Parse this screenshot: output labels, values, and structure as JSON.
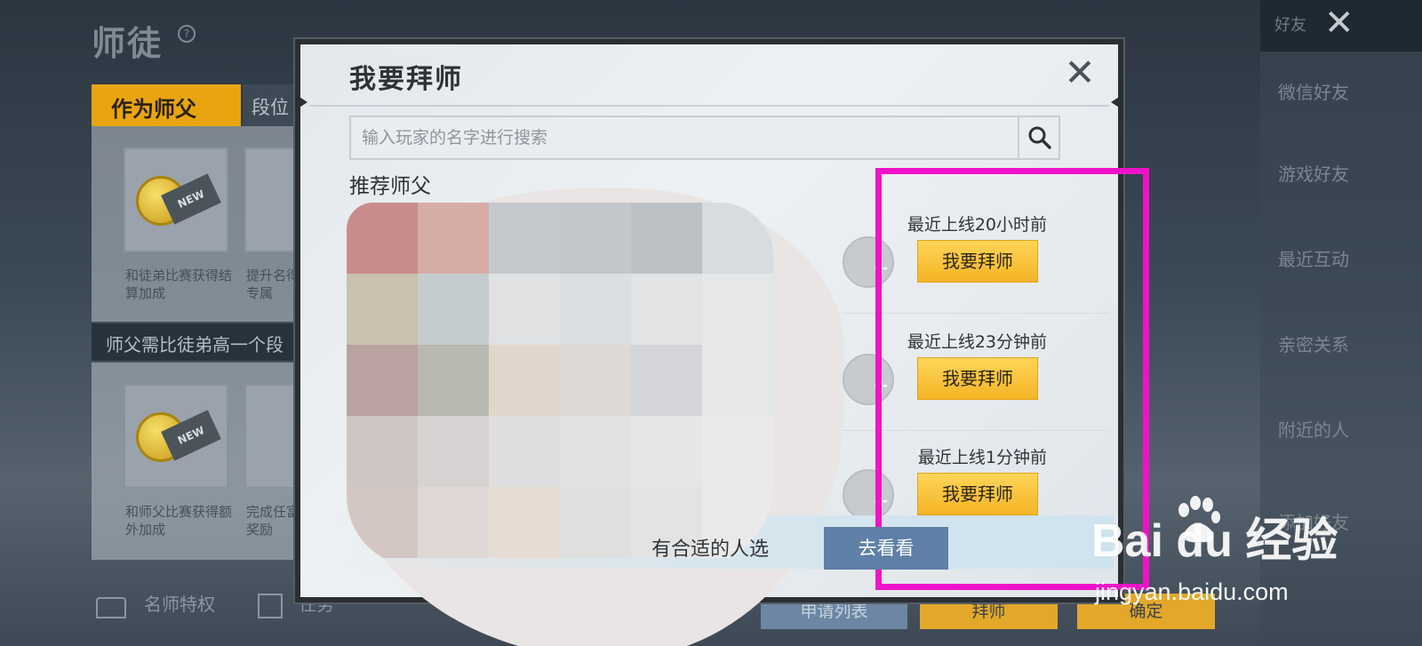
{
  "background": {
    "title": "师徒",
    "help_icon": "question-icon",
    "tabs": [
      {
        "label": "作为师父",
        "active": true
      },
      {
        "label": "段位",
        "active": false
      }
    ],
    "cards_row1": [
      {
        "text": "和徒弟比赛获得结算加成"
      },
      {
        "text": "提升名得专属"
      }
    ],
    "requirement_strip": "师父需比徒弟高一个段",
    "cards_row2": [
      {
        "text": "和师父比赛获得额外加成"
      },
      {
        "text": "完成任富奖励"
      }
    ],
    "badge_text": "NEW",
    "bottom_bar": {
      "privilege_label": "名师特权",
      "task_label": "任务",
      "apply_list_label": "申请列表",
      "apprentice_label": "拜师",
      "confirm_label": "确定"
    },
    "friends_panel": {
      "tab_label": "好友",
      "items": [
        "微信好友",
        "游戏好友",
        "最近互动",
        "亲密关系",
        "附近的人",
        "添加好友"
      ]
    }
  },
  "dialog": {
    "title": "我要拜师",
    "search": {
      "placeholder": "输入玩家的名字进行搜索"
    },
    "section_title": "推荐师父",
    "candidates": [
      {
        "status": "最近上线20小时前",
        "button_label": "我要拜师"
      },
      {
        "status": "最近上线23分钟前",
        "button_label": "我要拜师"
      },
      {
        "status": "最近上线1分钟前",
        "button_label": "我要拜师"
      }
    ],
    "footer": {
      "hint_text": "有合适的人选",
      "button_label": "去看看"
    }
  },
  "mosaic_colors": [
    [
      "#c98c8c",
      "#d6ada6",
      "#c4c8cc",
      "#c3c7cc",
      "#bcc1c6",
      "#d8dce0"
    ],
    [
      "#c9c0ad",
      "#c5ccce",
      "#dfe1e3",
      "#dcdfe2",
      "#e1e3e5",
      "#e5e7e8"
    ],
    [
      "#b9a29f",
      "#b8b9b0",
      "#e2d6cc",
      "#dfd9d6",
      "#d3d5d8",
      "#e6e7e8"
    ],
    [
      "#cfc5c2",
      "#d8d3d3",
      "#dedede",
      "#e3e2e2",
      "#e7e6e6",
      "#eaeaea"
    ],
    [
      "#d4c7c3",
      "#e0d8d5",
      "#e7dcd4",
      "#dfdfdf",
      "#e3e3e3",
      "#eaeaea"
    ]
  ],
  "annotation": {
    "color": "#f012c8"
  },
  "watermark": {
    "logo_text": "Bai du 经验",
    "url": "jingyan.baidu.com"
  },
  "colors": {
    "button_yellow": "#f4b425",
    "footer_button_blue": "#5f80a6",
    "tab_active_orange": "#e8a50f"
  }
}
